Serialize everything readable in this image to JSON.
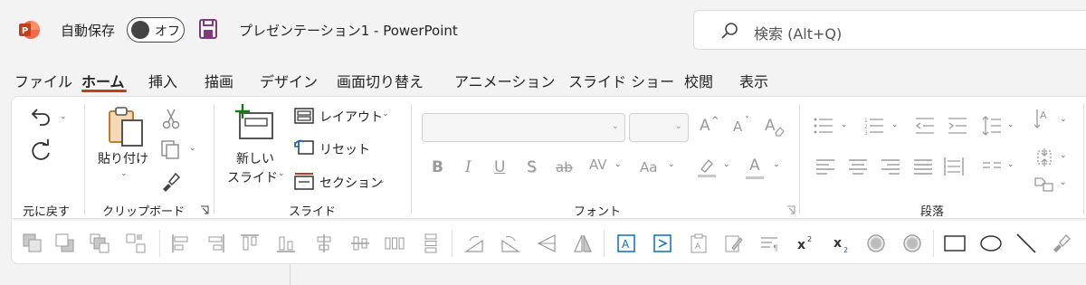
{
  "titlebar": {
    "autosave_label": "自動保存",
    "autosave_state": "オフ",
    "document_title": "プレゼンテーション1  -  PowerPoint",
    "search_placeholder": "検索 (Alt+Q)",
    "brand_color": "#c43e1c"
  },
  "tabs": [
    {
      "label": "ファイル"
    },
    {
      "label": "ホーム",
      "active": true
    },
    {
      "label": "挿入"
    },
    {
      "label": "描画"
    },
    {
      "label": "デザイン"
    },
    {
      "label": "画面切り替え"
    },
    {
      "label": "アニメーション"
    },
    {
      "label": "スライド ショー"
    },
    {
      "label": "校閲"
    },
    {
      "label": "表示"
    }
  ],
  "ribbon": {
    "undo_group": {
      "label": "元に戻す"
    },
    "clipboard": {
      "label": "クリップボード",
      "paste_label": "貼り付け"
    },
    "slides": {
      "label": "スライド",
      "new_slide_line1": "新しい",
      "new_slide_line2": "スライド",
      "layout": "レイアウト",
      "reset": "リセット",
      "section": "セクション"
    },
    "font": {
      "label": "フォント",
      "bold": "B",
      "italic": "I",
      "underline": "U",
      "shadow": "S",
      "strike": "ab",
      "spacing": "AV",
      "case": "Aa",
      "grow": "A",
      "shrink": "A",
      "clear": "A",
      "font_color": "A"
    },
    "paragraph": {
      "label": "段落"
    }
  }
}
